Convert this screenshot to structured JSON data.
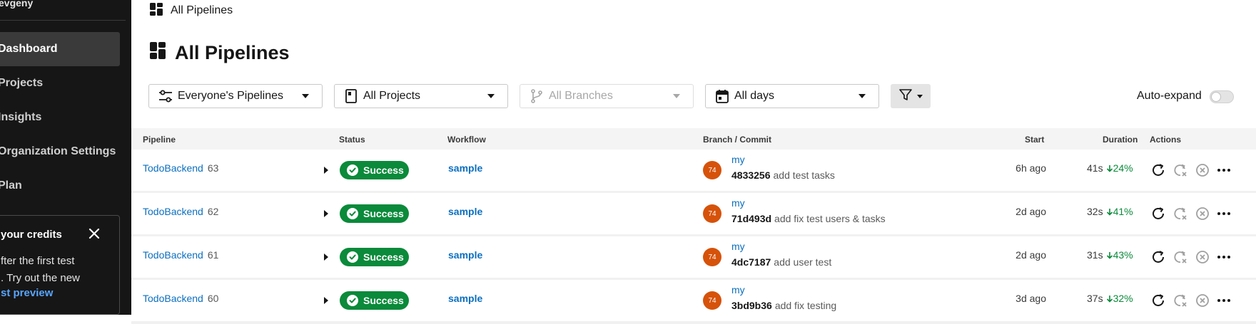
{
  "sidebar": {
    "user": "evgeny",
    "items": [
      {
        "label": "Dashboard",
        "active": true
      },
      {
        "label": "Projects",
        "active": false
      },
      {
        "label": "Insights",
        "active": false
      },
      {
        "label": "Organization Settings",
        "active": false
      },
      {
        "label": "Plan",
        "active": false
      }
    ],
    "credits_card": {
      "title": "your credits",
      "text_line1": "fter the first test",
      "text_line2": ". Try out the new",
      "link": "st preview"
    }
  },
  "breadcrumb": {
    "label": "All Pipelines",
    "icon": "dashboard-icon"
  },
  "page": {
    "title": "All Pipelines"
  },
  "filters": {
    "pipelines": "Everyone's Pipelines",
    "projects": "All Projects",
    "branches": "All Branches",
    "days": "All days",
    "auto_expand_label": "Auto-expand",
    "auto_expand_on": false
  },
  "table": {
    "headers": {
      "pipeline": "Pipeline",
      "status": "Status",
      "workflow": "Workflow",
      "branch_commit": "Branch / Commit",
      "start": "Start",
      "duration": "Duration",
      "actions": "Actions"
    },
    "rows": [
      {
        "project": "TodoBackend",
        "number": "63",
        "status": "Success",
        "workflow": "sample",
        "avatar": "74",
        "branch": "my",
        "sha": "4833256",
        "message": "add test tasks",
        "start": "6h ago",
        "duration": "41s",
        "change": "24%"
      },
      {
        "project": "TodoBackend",
        "number": "62",
        "status": "Success",
        "workflow": "sample",
        "avatar": "74",
        "branch": "my",
        "sha": "71d493d",
        "message": "add fix test users & tasks",
        "start": "2d ago",
        "duration": "32s",
        "change": "41%"
      },
      {
        "project": "TodoBackend",
        "number": "61",
        "status": "Success",
        "workflow": "sample",
        "avatar": "74",
        "branch": "my",
        "sha": "4dc7187",
        "message": "add user test",
        "start": "2d ago",
        "duration": "31s",
        "change": "43%"
      },
      {
        "project": "TodoBackend",
        "number": "60",
        "status": "Success",
        "workflow": "sample",
        "avatar": "74",
        "branch": "my",
        "sha": "3bd9b36",
        "message": "add fix testing",
        "start": "3d ago",
        "duration": "37s",
        "change": "32%"
      }
    ]
  },
  "colors": {
    "success": "#0a8a3a",
    "link": "#0b6fbf",
    "avatar": "#d6520a",
    "sidebar_bg": "#161616"
  }
}
